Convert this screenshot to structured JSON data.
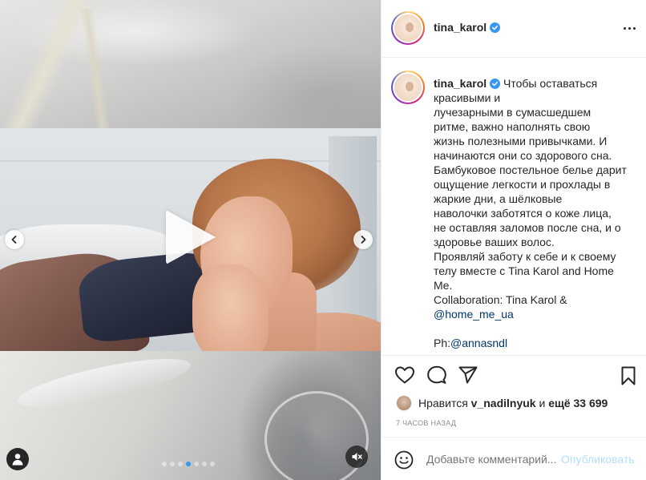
{
  "post": {
    "username": "tina_karol",
    "verified": true,
    "caption_lines": [
      "Чтобы оставаться",
      "красивыми и",
      "лучезарными в сумасшедшем",
      "ритме, важно наполнять свою",
      "жизнь полезными привычками. И",
      "начинаются они со здорового сна.",
      "Бамбуковое постельное белье дарит",
      "ощущение легкости и прохлады в",
      "жаркие дни, а шёлковые",
      "наволочки заботятся о коже лица,",
      "не оставляя заломов после сна, и о",
      "здоровье ваших волос.",
      "Проявляй заботу к себе и к своему",
      "телу вместе с Tina Karol and Home",
      "Me.",
      "Collaboration: Tina Karol &"
    ],
    "mention_home": "@home_me_ua",
    "photo_credit_prefix": "Ph:",
    "mention_photographer": "@annasndl"
  },
  "likes": {
    "prefix": "Нравится",
    "user": "v_nadilnyuk",
    "middle": "и",
    "count_text": "ещё 33 699"
  },
  "timestamp": "7 часов назад",
  "comment": {
    "placeholder": "Добавьте комментарий...",
    "publish_label": "Опубликовать"
  },
  "carousel": {
    "slide_count": 7,
    "active_index": 3
  },
  "colors": {
    "accent": "#3897f0",
    "link": "#00376b",
    "publish_disabled": "#b2dffc",
    "muted_text": "#8e8e8e"
  },
  "icons": [
    "play-icon",
    "chevron-left-icon",
    "chevron-right-icon",
    "user-tag-icon",
    "mute-icon",
    "heart-icon",
    "comment-icon",
    "share-icon",
    "bookmark-icon",
    "emoji-icon",
    "more-icon",
    "verified-icon"
  ]
}
